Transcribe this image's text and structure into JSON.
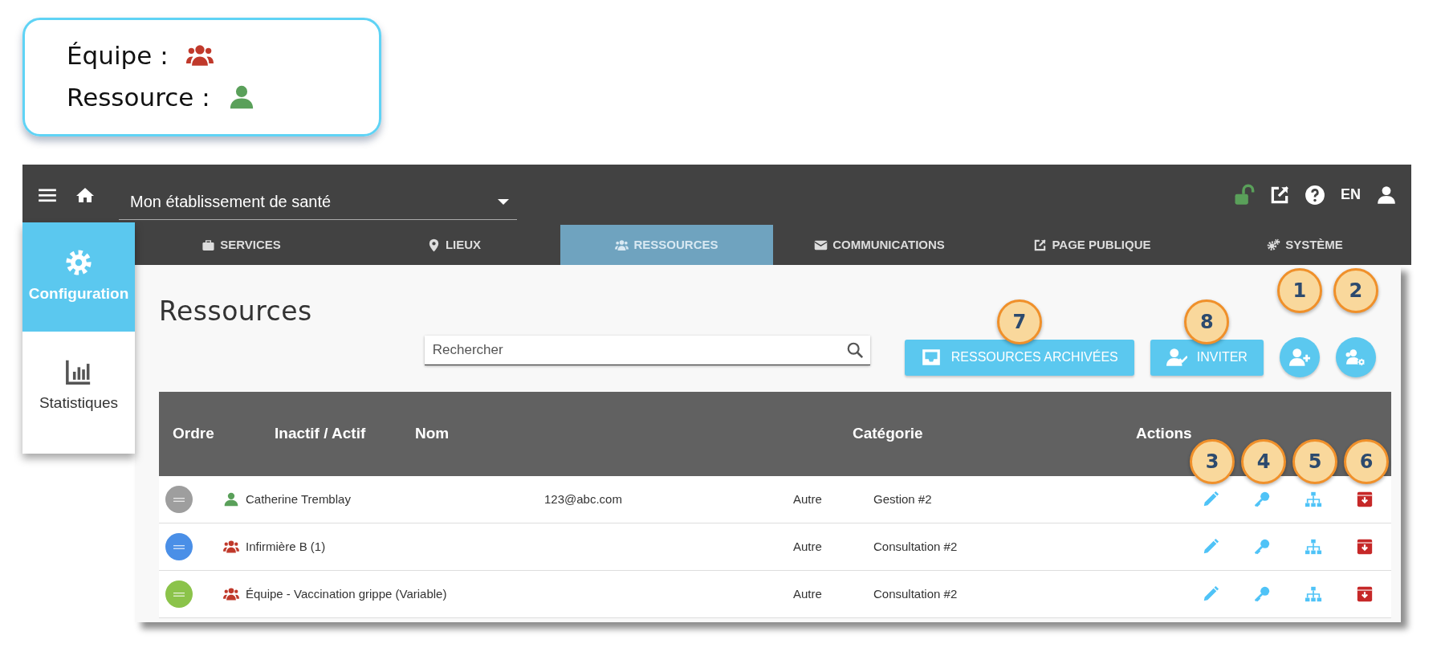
{
  "legend": [
    {
      "label": "Équipe :",
      "kind": "team"
    },
    {
      "label": "Ressource :",
      "kind": "resource"
    }
  ],
  "topbar": {
    "establishment": "Mon établissement de santé",
    "language": "EN"
  },
  "sidebar": [
    {
      "label": "Configuration",
      "kind": "gear",
      "selected": true
    },
    {
      "label": "Statistiques",
      "kind": "chart",
      "selected": false
    }
  ],
  "tabs": [
    {
      "label": "SERVICES",
      "kind": "briefcase",
      "selected": false
    },
    {
      "label": "LIEUX",
      "kind": "pin",
      "selected": false
    },
    {
      "label": "RESSOURCES",
      "kind": "team",
      "selected": true
    },
    {
      "label": "COMMUNICATIONS",
      "kind": "envelope",
      "selected": false
    },
    {
      "label": "PAGE PUBLIQUE",
      "kind": "external",
      "selected": false
    },
    {
      "label": "SYSTÈME",
      "kind": "gears",
      "selected": false
    }
  ],
  "title": "Ressources",
  "search": {
    "placeholder": "Rechercher"
  },
  "buttons": [
    {
      "label": "RESSOURCES ARCHIVÉES",
      "kind": "archive",
      "callout": "7"
    },
    {
      "label": "INVITER",
      "kind": "invite",
      "callout": "8"
    },
    {
      "kind": "add-person",
      "callout": "1"
    },
    {
      "kind": "add-team",
      "callout": "2"
    }
  ],
  "table": {
    "columns": [
      "Ordre",
      "Inactif / Actif",
      "Nom",
      "Catégorie",
      "Actions"
    ],
    "action_callouts": [
      "3",
      "4",
      "5",
      "6"
    ],
    "rows": [
      {
        "color": "#9e9e9e",
        "kind": "resource",
        "name": "Catherine Tremblay",
        "email": "123@abc.com",
        "column_5": "Autre",
        "category": "Gestion #2"
      },
      {
        "color": "#4a8fe7",
        "kind": "team",
        "name": "Infirmière B (1)",
        "column_5": "Autre",
        "category": "Consultation #2"
      },
      {
        "color": "#8bc34a",
        "kind": "team",
        "name": "Équipe - Vaccination grippe (Variable)",
        "column_5": "Autre",
        "category": "Consultation #2"
      }
    ]
  }
}
